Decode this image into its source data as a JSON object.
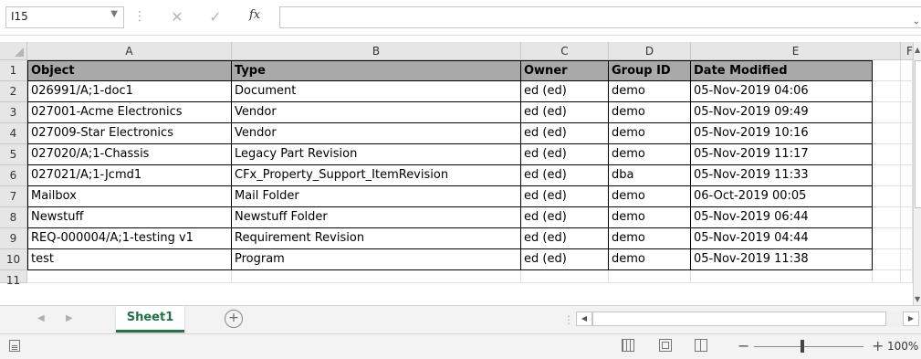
{
  "formula_bar": {
    "name_box": "I15",
    "name_box_dropdown_icon": "chevron-down-icon",
    "cancel_icon": "close-icon",
    "enter_icon": "check-icon",
    "fx_label": "fx",
    "formula_value": ""
  },
  "columns": [
    "A",
    "B",
    "C",
    "D",
    "E",
    "F"
  ],
  "rows": [
    "1",
    "2",
    "3",
    "4",
    "5",
    "6",
    "7",
    "8",
    "9",
    "10",
    "11"
  ],
  "table": {
    "headers": [
      "Object",
      "Type",
      "Owner",
      "Group ID",
      "Date Modified"
    ],
    "rows": [
      [
        "026991/A;1-doc1",
        "Document",
        "ed (ed)",
        "demo",
        "05-Nov-2019 04:06"
      ],
      [
        "027001-Acme Electronics",
        "Vendor",
        "ed (ed)",
        "demo",
        "05-Nov-2019 09:49"
      ],
      [
        "027009-Star Electronics",
        "Vendor",
        "ed (ed)",
        "demo",
        "05-Nov-2019 10:16"
      ],
      [
        "027020/A;1-Chassis",
        "Legacy Part Revision",
        "ed (ed)",
        "demo",
        "05-Nov-2019 11:17"
      ],
      [
        "027021/A;1-Jcmd1",
        "CFx_Property_Support_ItemRevision",
        "ed (ed)",
        "dba",
        "05-Nov-2019 11:33"
      ],
      [
        "Mailbox",
        "Mail Folder",
        "ed (ed)",
        "demo",
        "06-Oct-2019 00:05"
      ],
      [
        "Newstuff",
        "Newstuff Folder",
        "ed (ed)",
        "demo",
        "05-Nov-2019 06:44"
      ],
      [
        "REQ-000004/A;1-testing v1",
        "Requirement Revision",
        "ed (ed)",
        "demo",
        "05-Nov-2019 04:44"
      ],
      [
        "test",
        "Program",
        "ed (ed)",
        "demo",
        "05-Nov-2019 11:38"
      ]
    ],
    "header_fill": "#a9a9a9"
  },
  "sheet_tabs": {
    "active": "Sheet1",
    "add_icon": "plus-circle-icon"
  },
  "status_bar": {
    "zoom": "100%",
    "zoom_minus": "−",
    "zoom_plus": "+"
  },
  "colors": {
    "accent": "#217346"
  }
}
